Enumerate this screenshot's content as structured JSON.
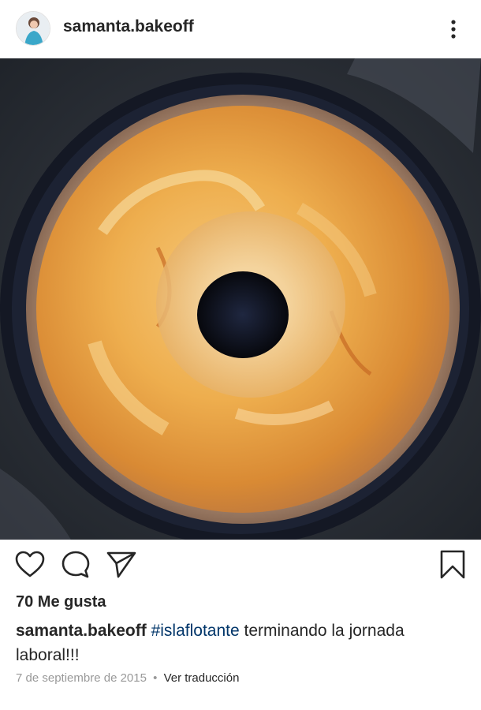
{
  "post": {
    "username": "samanta.bakeoff",
    "likes_text": "70 Me gusta",
    "caption": {
      "username": "samanta.bakeoff",
      "hashtag": "#islaflotante",
      "text": "terminando la jornada laboral!!!"
    },
    "date": "7 de septiembre de 2015",
    "separator": "•",
    "translate_label": "Ver traducción"
  },
  "icons": {
    "more": "more-vertical-icon",
    "like": "heart-icon",
    "comment": "comment-icon",
    "share": "send-icon",
    "save": "bookmark-icon"
  },
  "colors": {
    "text": "#262626",
    "hashtag": "#003569",
    "muted": "#999999"
  }
}
